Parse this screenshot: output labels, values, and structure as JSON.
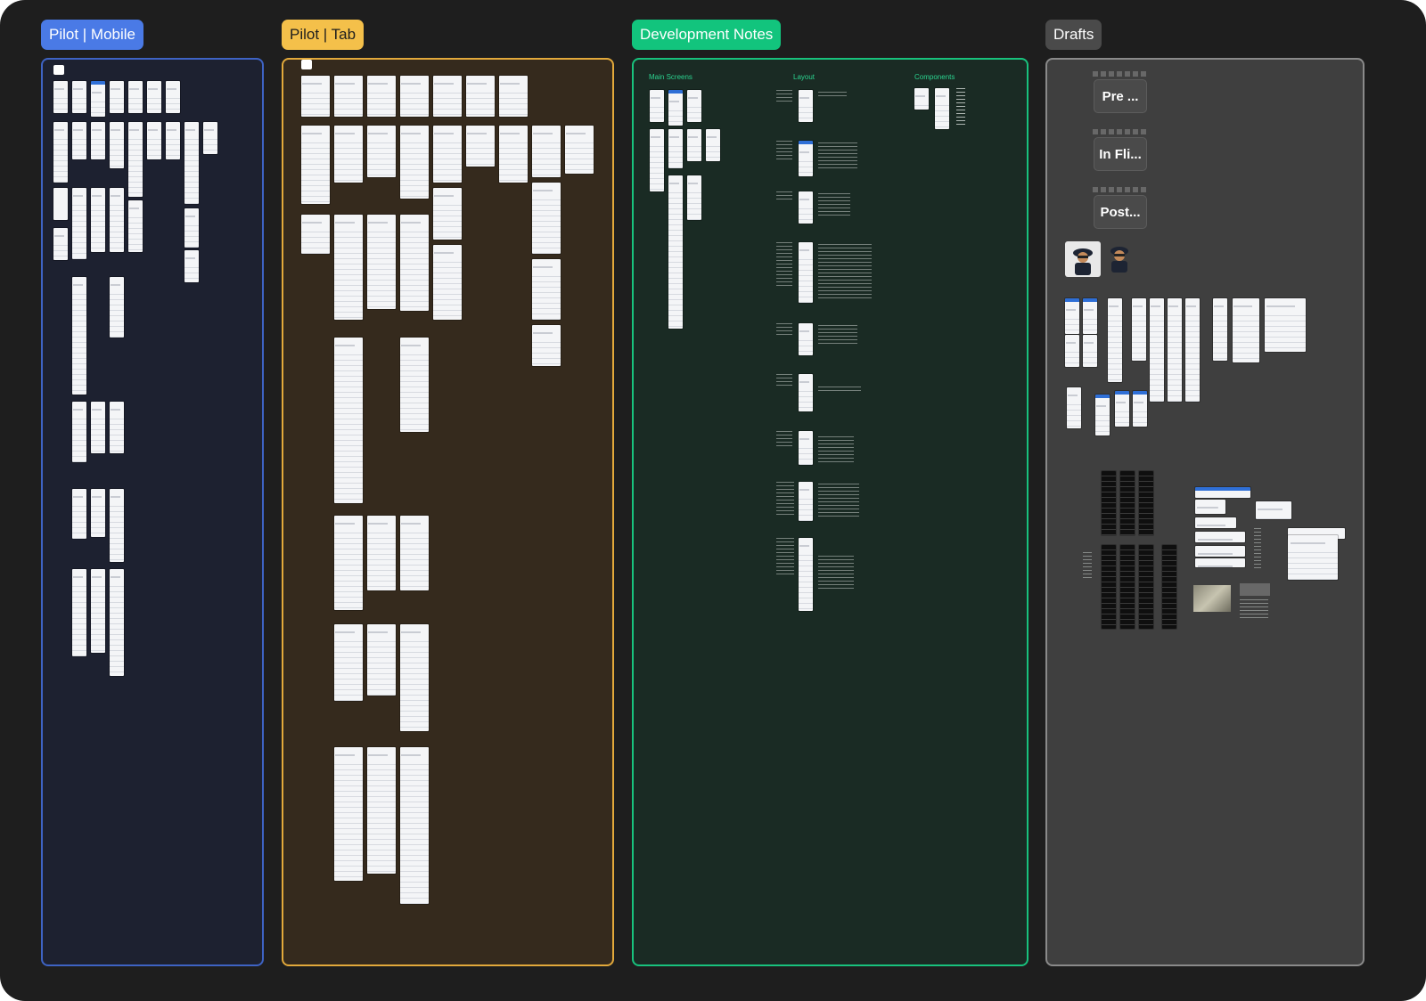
{
  "sections": [
    {
      "label": "Pilot | Mobile",
      "label_color": "#4a7ae6",
      "frame_color": "#3e63c4",
      "frame_bg": "#1d2130"
    },
    {
      "label": "Pilot | Tab",
      "label_color": "#f4c04a",
      "label_text_color": "#1e1e1e",
      "frame_color": "#e2a93b",
      "frame_bg": "#352a1d"
    },
    {
      "label": "Development Notes",
      "label_color": "#12c47d",
      "frame_color": "#18c27d",
      "frame_bg": "#1a2b24"
    },
    {
      "label": "Drafts",
      "label_color": "#4a4a4a",
      "frame_color": "#8a8a8a",
      "frame_bg": "#3f3f3f"
    }
  ],
  "dev_notes": {
    "column_headings": [
      "Main Screens",
      "Layout",
      "Components"
    ]
  },
  "drafts": {
    "cards": [
      "Pre ...",
      "In Fli...",
      "Post..."
    ]
  },
  "icons": [
    "figma-frame-icon",
    "avatar-pilot-image",
    "avatar-pilot-sticker-image"
  ]
}
